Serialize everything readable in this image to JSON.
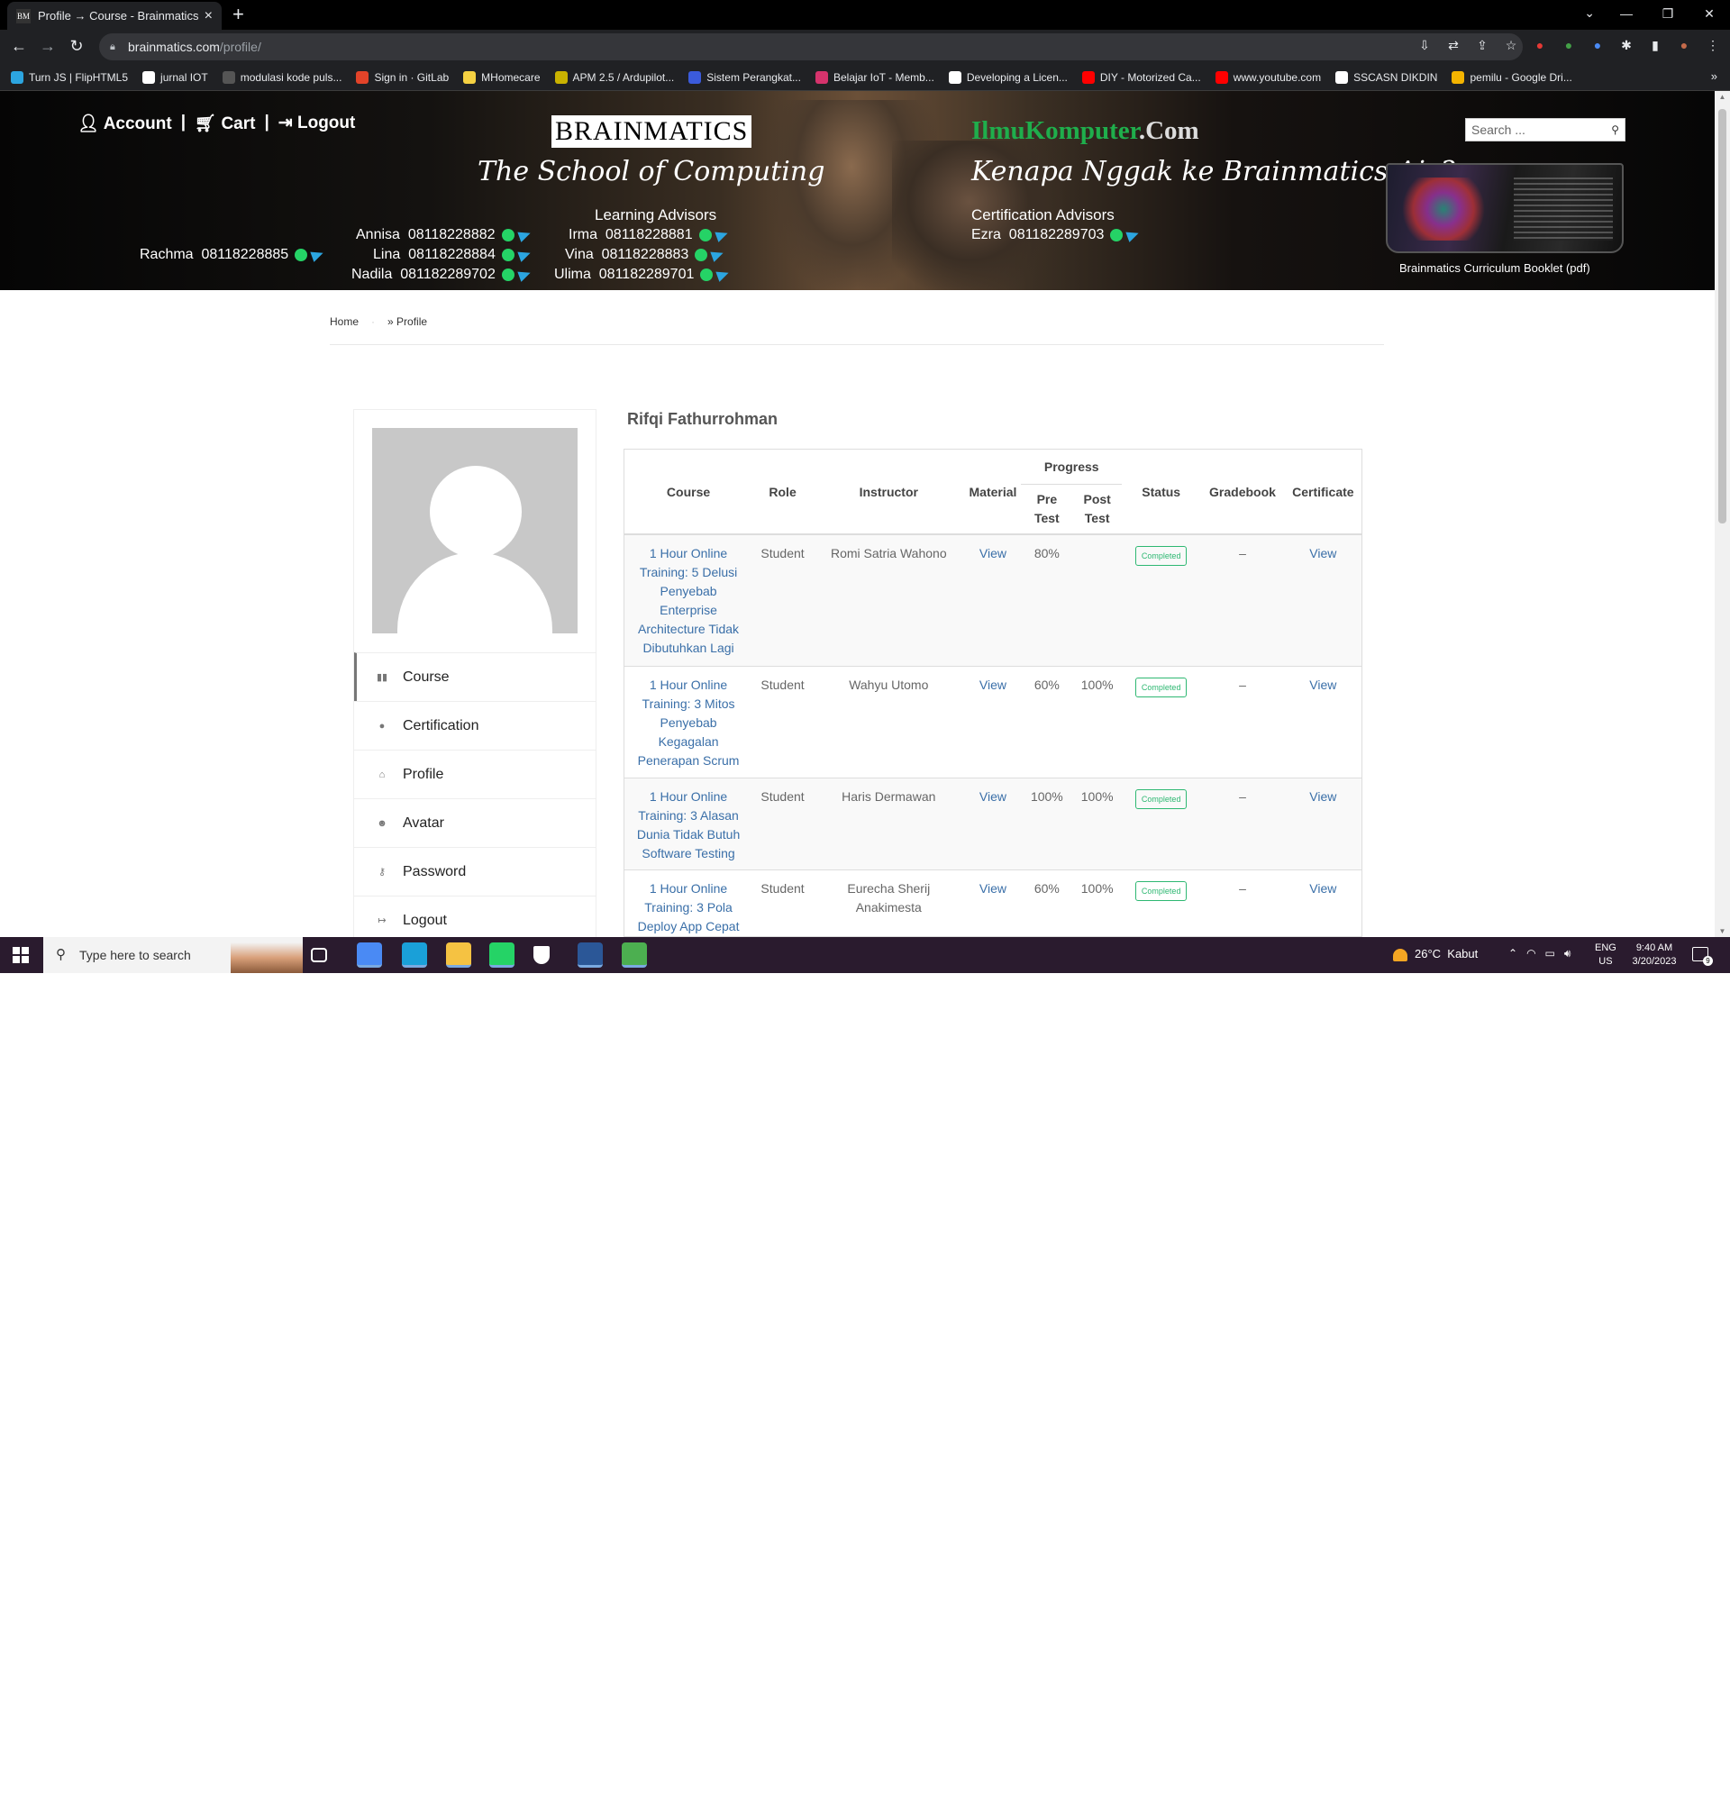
{
  "browser": {
    "tab_title": "Profile → Course - Brainmatics",
    "tab_favicon": "BM",
    "url_host": "brainmatics.com",
    "url_path": "/profile/",
    "bookmarks": [
      {
        "label": "Turn JS | FlipHTML5",
        "color": "#2ca5e0"
      },
      {
        "label": "jurnal IOT",
        "color": "#ffffff"
      },
      {
        "label": "modulasi kode puls...",
        "color": "#555555"
      },
      {
        "label": "Sign in · GitLab",
        "color": "#e24329"
      },
      {
        "label": "MHomecare",
        "color": "#f5d142"
      },
      {
        "label": "APM 2.5 / Ardupilot...",
        "color": "#c9b200"
      },
      {
        "label": "Sistem Perangkat...",
        "color": "#3b5bdb"
      },
      {
        "label": "Belajar IoT - Memb...",
        "color": "#d6336c"
      },
      {
        "label": "Developing a Licen...",
        "color": "#ffffff"
      },
      {
        "label": "DIY - Motorized Ca...",
        "color": "#ff0000"
      },
      {
        "label": "www.youtube.com",
        "color": "#ff0000"
      },
      {
        "label": "SSCASN DIKDIN",
        "color": "#ffffff"
      },
      {
        "label": "pemilu - Google Dri...",
        "color": "#f4b400"
      }
    ],
    "bookmarks_more": "»"
  },
  "banner": {
    "account": "Account",
    "cart": "Cart",
    "logout": "Logout",
    "sep": "|",
    "logo": "BRAINMATICS",
    "tagline": "The School of Computing",
    "learning_advisors_title": "Learning Advisors",
    "learning_advisors": [
      {
        "name": "Rachma",
        "phone": "08118228885"
      },
      {
        "name": "Annisa",
        "phone": "08118228882"
      },
      {
        "name": "Lina",
        "phone": "08118228884"
      },
      {
        "name": "Nadila",
        "phone": "081182289702"
      },
      {
        "name": "Irma",
        "phone": "08118228881"
      },
      {
        "name": "Vina",
        "phone": "08118228883"
      },
      {
        "name": "Ulima",
        "phone": "081182289701"
      }
    ],
    "ilkom_green": "IlmuKomputer",
    "ilkom_white": ".Com",
    "tagline2": "Kenapa Nggak ke Brainmatics Aja?",
    "certification_advisors_title": "Certification Advisors",
    "certification_advisors": [
      {
        "name": "Ezra",
        "phone": "081182289703"
      }
    ],
    "search_placeholder": "Search ...",
    "booklet_caption": "Brainmatics Curriculum Booklet (pdf)"
  },
  "breadcrumb": {
    "home": "Home",
    "current": "» Profile"
  },
  "sidebar": {
    "menu": [
      {
        "label": "Course",
        "icon": "book-icon",
        "glyph": "▮▮"
      },
      {
        "label": "Certification",
        "icon": "circle-icon",
        "glyph": "●"
      },
      {
        "label": "Profile",
        "icon": "home-icon",
        "glyph": "⌂"
      },
      {
        "label": "Avatar",
        "icon": "user-circle-icon",
        "glyph": "☻"
      },
      {
        "label": "Password",
        "icon": "key-icon",
        "glyph": "⚷"
      },
      {
        "label": "Logout",
        "icon": "sign-out-icon",
        "glyph": "↦"
      }
    ]
  },
  "profile": {
    "name": "Rifqi Fathurrohman"
  },
  "table": {
    "headers": {
      "course": "Course",
      "role": "Role",
      "instructor": "Instructor",
      "material": "Material",
      "progress": "Progress",
      "pre_test": "Pre Test",
      "post_test": "Post Test",
      "status": "Status",
      "gradebook": "Gradebook",
      "certificate": "Certificate"
    },
    "rows": [
      {
        "course": "1 Hour Online Training: 5 Delusi Penyebab Enterprise Architecture Tidak Dibutuhkan Lagi",
        "role": "Student",
        "instructor": "Romi Satria Wahono",
        "material": "View",
        "pre": "80%",
        "post": "",
        "status": "Completed",
        "gradebook": "–",
        "certificate": "View"
      },
      {
        "course": "1 Hour Online Training: 3 Mitos Penyebab Kegagalan Penerapan Scrum",
        "role": "Student",
        "instructor": "Wahyu Utomo",
        "material": "View",
        "pre": "60%",
        "post": "100%",
        "status": "Completed",
        "gradebook": "–",
        "certificate": "View"
      },
      {
        "course": "1 Hour Online Training: 3 Alasan Dunia Tidak Butuh Software Testing",
        "role": "Student",
        "instructor": "Haris Dermawan",
        "material": "View",
        "pre": "100%",
        "post": "100%",
        "status": "Completed",
        "gradebook": "–",
        "certificate": "View"
      },
      {
        "course": "1 Hour Online Training: 3 Pola Deploy App Cepat",
        "role": "Student",
        "instructor": "Eurecha Sherij Anakimesta",
        "material": "View",
        "pre": "60%",
        "post": "100%",
        "status": "Completed",
        "gradebook": "–",
        "certificate": "View"
      }
    ]
  },
  "taskbar": {
    "search_placeholder": "Type here to search",
    "weather_temp": "26°C",
    "weather_desc": "Kabut",
    "lang_1": "ENG",
    "lang_2": "US",
    "time": "9:40 AM",
    "date": "3/20/2023",
    "notif_count": "9",
    "apps": [
      {
        "icon": "task-view-icon",
        "color": "#2a1b2e"
      },
      {
        "icon": "chrome-icon",
        "color": "#4a8af4"
      },
      {
        "icon": "edge-icon",
        "color": "#1aa0d8"
      },
      {
        "icon": "file-explorer-icon",
        "color": "#f5c242"
      },
      {
        "icon": "whatsapp-icon",
        "color": "#25d366"
      },
      {
        "icon": "security-icon",
        "color": "#ffffff"
      },
      {
        "icon": "word-icon",
        "color": "#2b5797"
      },
      {
        "icon": "torrent-icon",
        "color": "#4caf50"
      }
    ]
  }
}
